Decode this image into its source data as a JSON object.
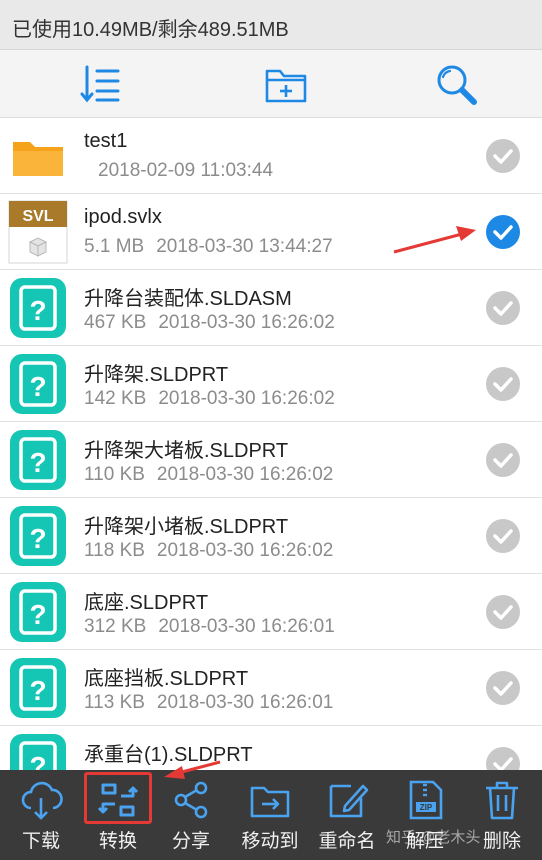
{
  "storage": {
    "text": "已使用10.49MB/剩余489.51MB"
  },
  "toolbar": {
    "icons": [
      "sort-list-icon",
      "new-folder-icon",
      "search-icon"
    ]
  },
  "files": [
    {
      "name": "test1",
      "size": "",
      "date": "2018-02-09 11:03:44",
      "type": "folder",
      "selected": false
    },
    {
      "name": "ipod.svlx",
      "size": "5.1 MB",
      "date": "2018-03-30 13:44:27",
      "type": "svl",
      "badge": "SVL",
      "selected": true
    },
    {
      "name": "升降台装配体.SLDASM",
      "size": "467 KB",
      "date": "2018-03-30 16:26:02",
      "type": "unknown",
      "selected": false
    },
    {
      "name": "升降架.SLDPRT",
      "size": "142 KB",
      "date": "2018-03-30 16:26:02",
      "type": "unknown",
      "selected": false
    },
    {
      "name": "升降架大堵板.SLDPRT",
      "size": "110 KB",
      "date": "2018-03-30 16:26:02",
      "type": "unknown",
      "selected": false
    },
    {
      "name": "升降架小堵板.SLDPRT",
      "size": "118 KB",
      "date": "2018-03-30 16:26:02",
      "type": "unknown",
      "selected": false
    },
    {
      "name": "底座.SLDPRT",
      "size": "312 KB",
      "date": "2018-03-30 16:26:01",
      "type": "unknown",
      "selected": false
    },
    {
      "name": "底座挡板.SLDPRT",
      "size": "113 KB",
      "date": "2018-03-30 16:26:01",
      "type": "unknown",
      "selected": false
    },
    {
      "name": "承重台(1).SLDPRT",
      "size": "",
      "date": "",
      "type": "unknown",
      "selected": false
    }
  ],
  "bottom_bar": {
    "items": [
      {
        "label": "下载",
        "icon": "cloud-download-icon"
      },
      {
        "label": "转换",
        "icon": "convert-icon"
      },
      {
        "label": "分享",
        "icon": "share-icon"
      },
      {
        "label": "移动到",
        "icon": "move-to-icon"
      },
      {
        "label": "重命名",
        "icon": "rename-icon"
      },
      {
        "label": "解压",
        "icon": "unzip-icon"
      },
      {
        "label": "删除",
        "icon": "trash-icon"
      }
    ]
  },
  "watermark": "知乎 @老木头",
  "colors": {
    "accent": "#1e88e5",
    "teal": "#16c6b4",
    "folder": "#f7a21b",
    "annotation": "#e53935"
  }
}
